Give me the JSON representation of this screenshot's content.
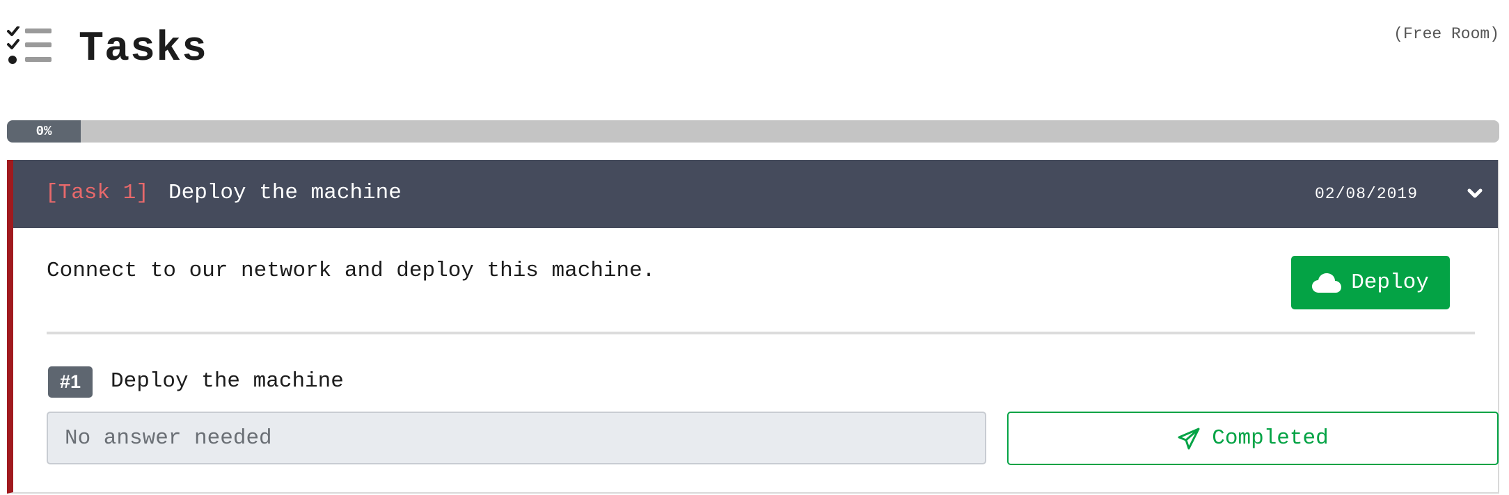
{
  "header": {
    "title": "Tasks",
    "room_type": "(Free Room)",
    "icon": "tasks-list-icon"
  },
  "progress": {
    "percent": 0,
    "label": "0%"
  },
  "task": {
    "tag": "[Task 1]",
    "title": "Deploy the machine",
    "date": "02/08/2019",
    "toggle_icon": "chevron-down-icon",
    "accent_color": "#a01a1e",
    "header_color": "#454b5c",
    "description": "Connect to our network and deploy this machine.",
    "deploy_label": "Deploy",
    "deploy_icon": "cloud-icon",
    "deploy_color": "#04a345",
    "questions": [
      {
        "badge": "#1",
        "text": "Deploy the machine",
        "answer_placeholder": "No answer needed",
        "submit_label": "Completed",
        "submit_icon": "paper-plane-icon"
      }
    ]
  }
}
